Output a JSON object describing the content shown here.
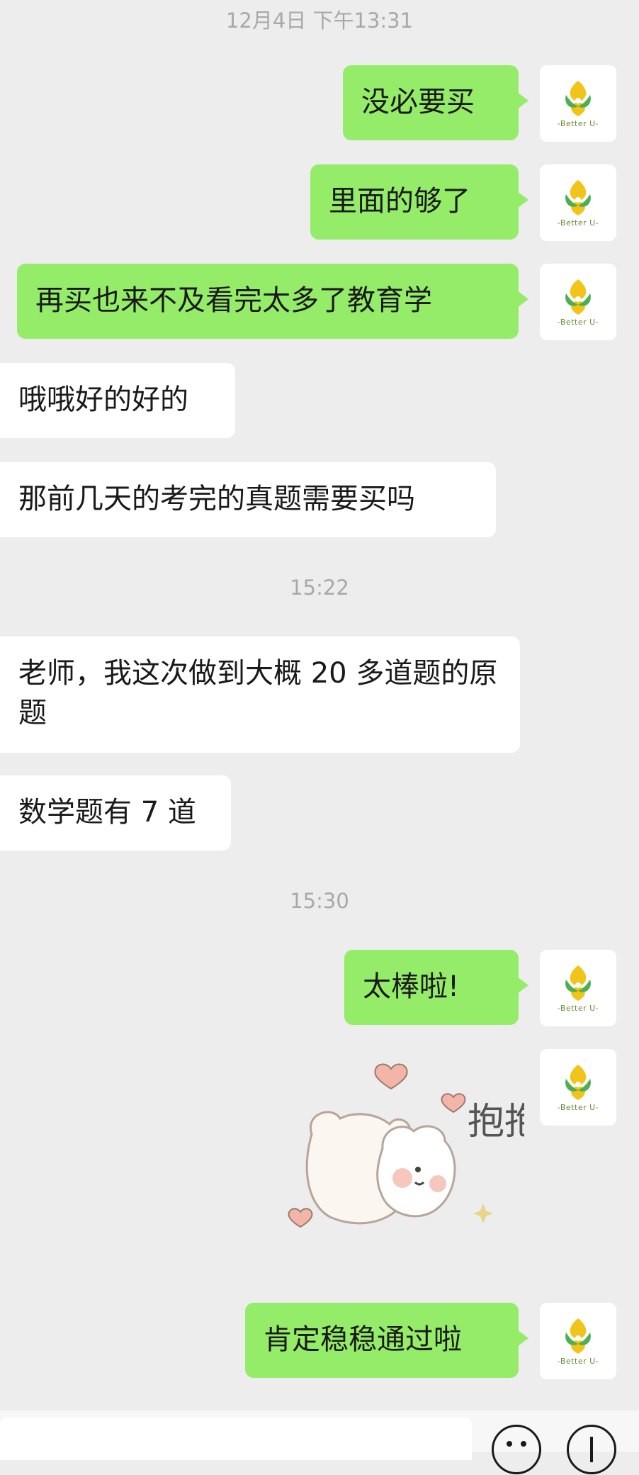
{
  "timestamps": [
    "12月4日 下午13:31",
    "15:22",
    "15:30"
  ],
  "avatar": {
    "brand": "-Better U-",
    "icon": "better-u-logo-icon"
  },
  "messages": [
    {
      "side": "me",
      "text": "没必要买"
    },
    {
      "side": "me",
      "text": "里面的够了"
    },
    {
      "side": "me",
      "text": "再买也来不及看完太多了教育学"
    },
    {
      "side": "them",
      "text": "哦哦好的好的"
    },
    {
      "side": "them",
      "text": "那前几天的考完的真题需要买吗"
    },
    {
      "side": "them",
      "text": "老师，我这次做到大概 20 多道题的原题"
    },
    {
      "side": "them",
      "text": "数学题有 7 道"
    },
    {
      "side": "me",
      "text": "太棒啦!"
    },
    {
      "side": "me",
      "type": "sticker",
      "text": "抱抱"
    },
    {
      "side": "me",
      "text": "肯定稳稳通过啦"
    }
  ],
  "input_bar": {
    "icons": [
      "emoji-icon",
      "plus-icon"
    ]
  },
  "colors": {
    "background": "#ededed",
    "my_bubble": "#95ec69",
    "their_bubble": "#ffffff",
    "timestamp": "#a8a8a8"
  }
}
